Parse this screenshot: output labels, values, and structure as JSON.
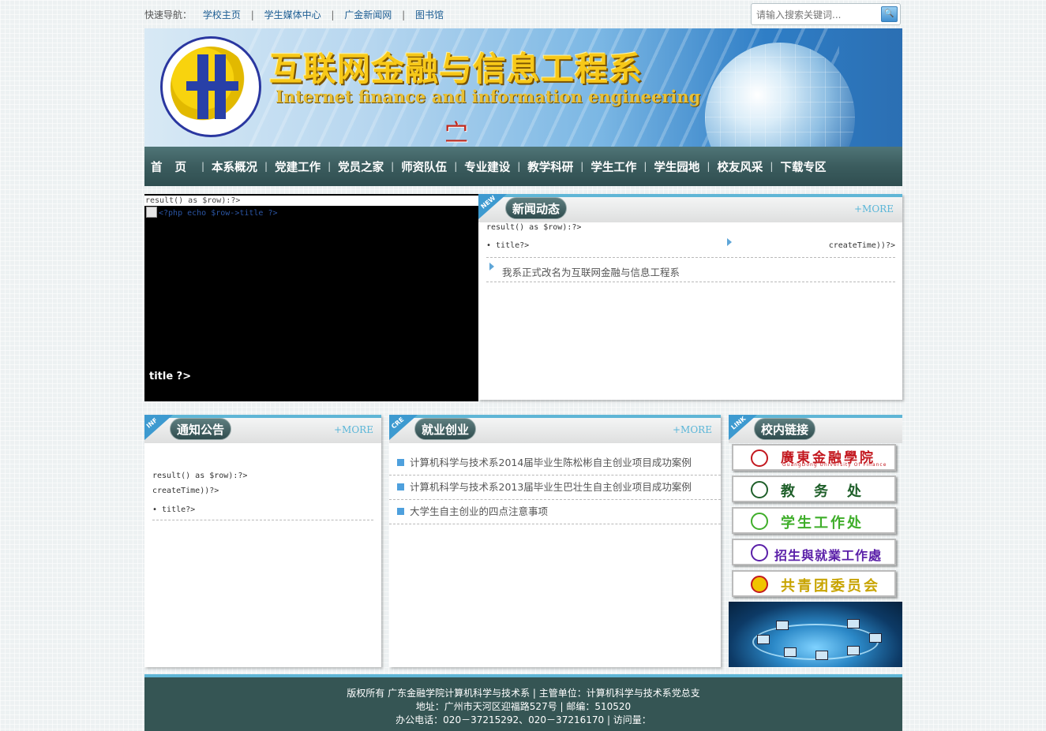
{
  "topbar": {
    "label": "快速导航：",
    "links": [
      "学校主页",
      "学生媒体中心",
      "广金新闻网",
      "图书馆"
    ],
    "separator": "|",
    "search_placeholder": "请输入搜索关键词...",
    "search_icon": "search-icon"
  },
  "banner": {
    "title": "互联网金融与信息工程系",
    "subtitle": "Internet finance and information engineering",
    "mark": "㝉"
  },
  "nav": {
    "items": [
      "首页",
      "本系概况",
      "党建工作",
      "党员之家",
      "师资队伍",
      "专业建设",
      "教学科研",
      "学生工作",
      "学生园地",
      "校友风采",
      "下载专区"
    ],
    "separator": "|"
  },
  "slideshow": {
    "code_line": "result() as $row):?>",
    "img_alt": "<?php echo $row->title ?>",
    "caption": "title ?>"
  },
  "news": {
    "corner": "NEW",
    "title": "新闻动态",
    "more": "+MORE",
    "code_line": "result() as $row):?>",
    "row1_title": "• title?>",
    "row1_time": "createTime))?>",
    "row2_title": "我系正式改名为互联网金融与信息工程系"
  },
  "notice": {
    "corner": "INF",
    "title": "通知公告",
    "more": "+MORE",
    "code_line": "result() as $row):?>",
    "time_line": "createTime))?>",
    "row_title": "• title?>"
  },
  "career": {
    "corner": "CRE",
    "title": "就业创业",
    "more": "+MORE",
    "items": [
      "计算机科学与技术系2014届毕业生陈松彬自主创业项目成功案例",
      "计算机科学与技术系2013届毕业生巴壮生自主创业项目成功案例",
      "大学生自主创业的四点注意事项"
    ]
  },
  "links": {
    "corner": "LINK",
    "title": "校内链接",
    "items": [
      {
        "label": "廣東金融學院",
        "color": "#c3181f"
      },
      {
        "label": "教　务　处",
        "color": "#1f5f2a"
      },
      {
        "label": "学生工作处",
        "color": "#3fae2a"
      },
      {
        "label": "招生與就業工作處",
        "color": "#5a1fa8"
      },
      {
        "label": "共青团委员会",
        "color": "#c8a400"
      }
    ],
    "school_sub": "GuangDong University Of Finance"
  },
  "footer": {
    "line1": "版权所有 广东金融学院计算机科学与技术系 | 主管单位：计算机科学与技术系党总支",
    "line2": "地址：广州市天河区迎福路527号 | 邮编：510520",
    "line3": "办公电话：020－37215292、020－37216170 | 访问量："
  }
}
